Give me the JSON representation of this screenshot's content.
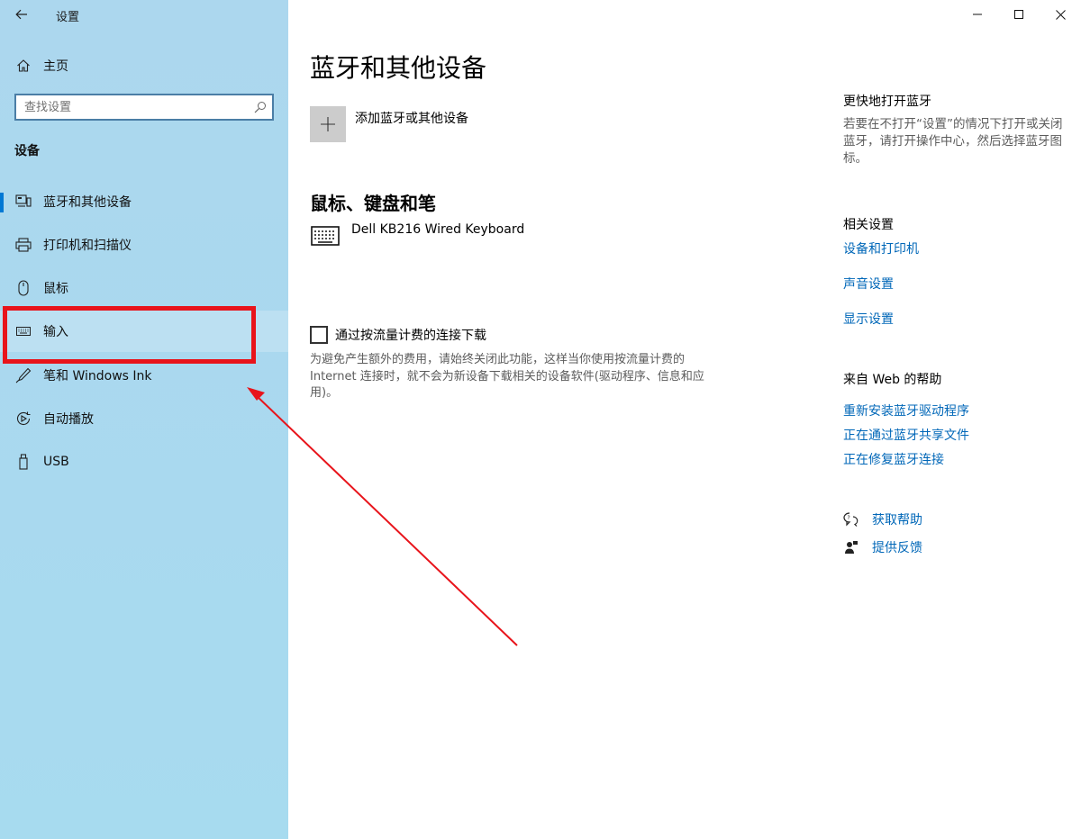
{
  "window": {
    "title": "设置",
    "controls": [
      "minimize",
      "maximize",
      "close"
    ]
  },
  "sidebar": {
    "home_label": "主页",
    "search": {
      "placeholder": "查找设置",
      "value": ""
    },
    "section_title": "设备",
    "items": [
      {
        "label": "蓝牙和其他设备",
        "icon": "bluetooth-devices-icon",
        "selected": true
      },
      {
        "label": "打印机和扫描仪",
        "icon": "printer-icon",
        "selected": false
      },
      {
        "label": "鼠标",
        "icon": "mouse-icon",
        "selected": false
      },
      {
        "label": "输入",
        "icon": "keyboard-icon",
        "selected": false
      },
      {
        "label": "笔和 Windows Ink",
        "icon": "pen-icon",
        "selected": false
      },
      {
        "label": "自动播放",
        "icon": "autoplay-icon",
        "selected": false
      },
      {
        "label": "USB",
        "icon": "usb-icon",
        "selected": false
      }
    ]
  },
  "main": {
    "title": "蓝牙和其他设备",
    "add_device_label": "添加蓝牙或其他设备",
    "input_section_title": "鼠标、键盘和笔",
    "devices": [
      {
        "name": "Dell KB216 Wired Keyboard",
        "icon": "keyboard-icon"
      }
    ],
    "metered_checkbox": {
      "label": "通过按流量计费的连接下载",
      "checked": false,
      "description": "为避免产生额外的费用，请始终关闭此功能，这样当你使用按流量计费的Internet 连接时，就不会为新设备下载相关的设备软件(驱动程序、信息和应用)。"
    }
  },
  "right": {
    "quick_title": "更快地打开蓝牙",
    "quick_text": "若要在不打开“设置”的情况下打开或关闭蓝牙，请打开操作中心，然后选择蓝牙图标。",
    "related_title": "相关设置",
    "related_links": [
      "设备和打印机",
      "声音设置",
      "显示设置"
    ],
    "web_help_title": "来自 Web 的帮助",
    "web_help_links": [
      "重新安装蓝牙驱动程序",
      "正在通过蓝牙共享文件",
      "正在修复蓝牙连接"
    ],
    "get_help_label": "获取帮助",
    "feedback_label": "提供反馈"
  },
  "colors": {
    "sidebar_bg": "#acd7ee",
    "accent": "#0078d4",
    "link": "#0067b8",
    "annotation_red": "#e8141b"
  }
}
